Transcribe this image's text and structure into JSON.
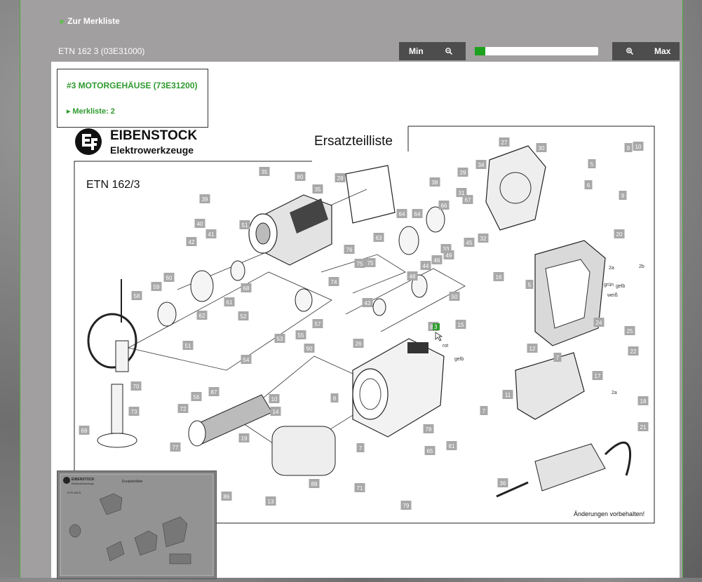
{
  "header": {
    "back_link": "Zur Merkliste",
    "model_title": "ETN 162 3 (03E31000)"
  },
  "zoom": {
    "min_label": "Min",
    "max_label": "Max",
    "level": 0.0
  },
  "info": {
    "part_title": "#3 MOTORGEHÄUSE (73E31200)",
    "merkliste": "Merkliste: 2"
  },
  "drawing": {
    "brand": "EIBENSTOCK",
    "brand_sub": "Elektrowerkzeuge",
    "sheet_title": "Ersatzteilliste",
    "model": "ETN 162/3",
    "footer": "Änderungen vorbehalten!",
    "minimap_brand": "EIBENSTOCK",
    "minimap_sub": "Elektrowerkzeuge",
    "minimap_title": "Ersatzteilliste",
    "minimap_model": "ETN 162/3",
    "highlighted_part": "3",
    "wire_labels": [
      "grün",
      "weiß",
      "gelb",
      "rot",
      "gelb",
      "2a",
      "2b",
      "2a"
    ]
  },
  "parts": [
    "1",
    "2",
    "3",
    "4",
    "5",
    "5",
    "6",
    "7",
    "7",
    "7",
    "8",
    "9",
    "9",
    "10",
    "10",
    "11",
    "12",
    "13",
    "14",
    "15",
    "16",
    "17",
    "18",
    "19",
    "20",
    "21",
    "22",
    "24",
    "25",
    "26",
    "27",
    "28",
    "29",
    "30",
    "31",
    "32",
    "33",
    "34",
    "35",
    "35",
    "36",
    "38",
    "39",
    "40",
    "41",
    "42",
    "43",
    "44",
    "45",
    "46",
    "48",
    "49",
    "50",
    "51",
    "51",
    "52",
    "53",
    "54",
    "55",
    "56",
    "57",
    "58",
    "59",
    "60",
    "61",
    "62",
    "63",
    "64",
    "64",
    "65",
    "66",
    "67",
    "68",
    "69",
    "70",
    "71",
    "72",
    "73",
    "74",
    "75",
    "75",
    "76",
    "77",
    "78",
    "79",
    "80",
    "81",
    "86",
    "87",
    "88",
    "89",
    "90"
  ],
  "colors": {
    "accent_green": "#2f9a2f",
    "slider_handle": "#1ea11e",
    "frame_bg": "#a19f9f",
    "button_bg": "#4d4d4d",
    "part_tag_bg": "#a8a8a8"
  }
}
